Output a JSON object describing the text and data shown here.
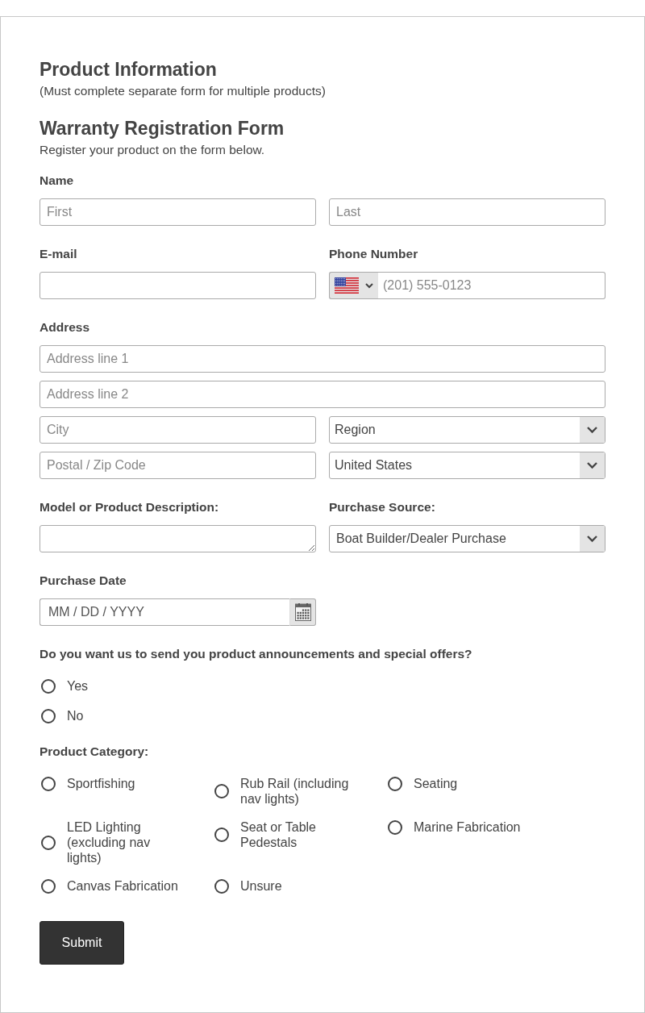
{
  "header": {
    "title": "Product Information",
    "note": "(Must complete separate form for multiple products)"
  },
  "form": {
    "title": "Warranty Registration Form",
    "description": "Register your product on the form below."
  },
  "name": {
    "label": "Name",
    "first": {
      "placeholder": "First"
    },
    "last": {
      "placeholder": "Last"
    }
  },
  "email": {
    "label": "E-mail"
  },
  "phone": {
    "label": "Phone Number",
    "placeholder": "(201) 555-0123"
  },
  "address": {
    "label": "Address",
    "line_1": {
      "placeholder": "Address line 1"
    },
    "line_2": {
      "placeholder": "Address line 2"
    },
    "city": {
      "placeholder": "City"
    },
    "region": {
      "value": "Region"
    },
    "postal_code": {
      "placeholder": "Postal / Zip Code"
    },
    "country": {
      "value": "United States"
    }
  },
  "model": {
    "label": "Model or Product Description:"
  },
  "purchase_source": {
    "label": "Purchase Source:",
    "value": "Boat Builder/Dealer Purchase"
  },
  "purchase_date": {
    "label": "Purchase Date",
    "placeholder": "MM / DD / YYYY"
  },
  "announcements": {
    "question": "Do you want us to send you product announcements and special offers?",
    "options": [
      {
        "label": "Yes",
        "selected": false
      },
      {
        "label": "No",
        "selected": false
      }
    ]
  },
  "product_category": {
    "label": "Product Category:",
    "options": [
      {
        "label": "Sportfishing",
        "selected": false
      },
      {
        "label": "Rub Rail (including nav lights)",
        "selected": false
      },
      {
        "label": "Seating",
        "selected": false
      },
      {
        "label": "LED Lighting (excluding nav lights)",
        "selected": false
      },
      {
        "label": "Seat or Table Pedestals",
        "selected": false
      },
      {
        "label": "Marine Fabrication",
        "selected": false
      },
      {
        "label": "Canvas Fabrication",
        "selected": false
      },
      {
        "label": "Unsure",
        "selected": false
      }
    ]
  },
  "submit": {
    "label": "Submit"
  }
}
